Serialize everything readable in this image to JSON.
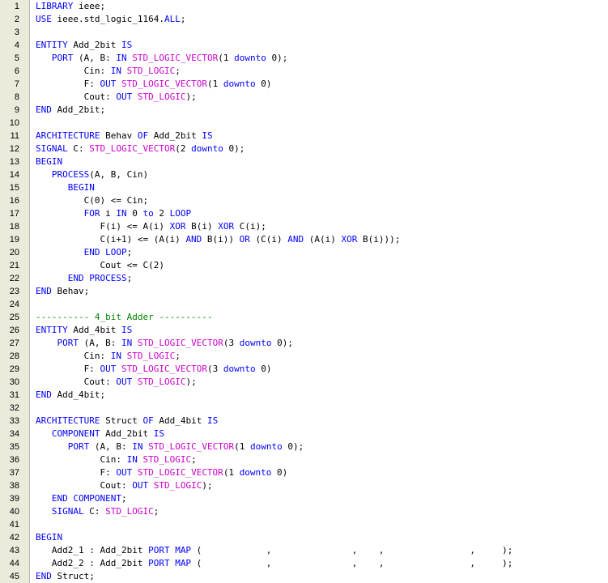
{
  "colors": {
    "keyword": "#0000ff",
    "type": "#cc00cc",
    "comment": "#008000",
    "text": "#000000",
    "gutter": "#ebebdc"
  },
  "lines": [
    [
      [
        "k",
        "LIBRARY"
      ],
      [
        "n",
        " ieee;"
      ]
    ],
    [
      [
        "k",
        "USE"
      ],
      [
        "n",
        " ieee.std_logic_1164."
      ],
      [
        "k",
        "ALL"
      ],
      [
        "n",
        ";"
      ]
    ],
    [],
    [
      [
        "k",
        "ENTITY"
      ],
      [
        "n",
        " Add_2bit "
      ],
      [
        "k",
        "IS"
      ]
    ],
    [
      [
        "n",
        "   "
      ],
      [
        "k",
        "PORT"
      ],
      [
        "n",
        " (A, B: "
      ],
      [
        "k",
        "IN"
      ],
      [
        "n",
        " "
      ],
      [
        "t",
        "STD_LOGIC_VECTOR"
      ],
      [
        "n",
        "(1 "
      ],
      [
        "k",
        "downto"
      ],
      [
        "n",
        " 0);"
      ]
    ],
    [
      [
        "n",
        "         Cin: "
      ],
      [
        "k",
        "IN"
      ],
      [
        "n",
        " "
      ],
      [
        "t",
        "STD_LOGIC"
      ],
      [
        "n",
        ";"
      ]
    ],
    [
      [
        "n",
        "         F: "
      ],
      [
        "k",
        "OUT"
      ],
      [
        "n",
        " "
      ],
      [
        "t",
        "STD_LOGIC_VECTOR"
      ],
      [
        "n",
        "(1 "
      ],
      [
        "k",
        "downto"
      ],
      [
        "n",
        " 0)"
      ]
    ],
    [
      [
        "n",
        "         Cout: "
      ],
      [
        "k",
        "OUT"
      ],
      [
        "n",
        " "
      ],
      [
        "t",
        "STD_LOGIC"
      ],
      [
        "n",
        ");"
      ]
    ],
    [
      [
        "k",
        "END"
      ],
      [
        "n",
        " Add_2bit;"
      ]
    ],
    [],
    [
      [
        "k",
        "ARCHITECTURE"
      ],
      [
        "n",
        " Behav "
      ],
      [
        "k",
        "OF"
      ],
      [
        "n",
        " Add_2bit "
      ],
      [
        "k",
        "IS"
      ]
    ],
    [
      [
        "k",
        "SIGNAL"
      ],
      [
        "n",
        " C: "
      ],
      [
        "t",
        "STD_LOGIC_VECTOR"
      ],
      [
        "n",
        "(2 "
      ],
      [
        "k",
        "downto"
      ],
      [
        "n",
        " 0);"
      ]
    ],
    [
      [
        "k",
        "BEGIN"
      ]
    ],
    [
      [
        "n",
        "   "
      ],
      [
        "k",
        "PROCESS"
      ],
      [
        "n",
        "(A, B, Cin)"
      ]
    ],
    [
      [
        "n",
        "      "
      ],
      [
        "k",
        "BEGIN"
      ]
    ],
    [
      [
        "n",
        "         C(0) <= Cin;"
      ]
    ],
    [
      [
        "n",
        "         "
      ],
      [
        "k",
        "FOR"
      ],
      [
        "n",
        " i "
      ],
      [
        "k",
        "IN"
      ],
      [
        "n",
        " 0 "
      ],
      [
        "k",
        "to"
      ],
      [
        "n",
        " 2 "
      ],
      [
        "k",
        "LOOP"
      ]
    ],
    [
      [
        "n",
        "            F(i) <= A(i) "
      ],
      [
        "k",
        "XOR"
      ],
      [
        "n",
        " B(i) "
      ],
      [
        "k",
        "XOR"
      ],
      [
        "n",
        " C(i);"
      ]
    ],
    [
      [
        "n",
        "            C(i+1) <= (A(i) "
      ],
      [
        "k",
        "AND"
      ],
      [
        "n",
        " B(i)) "
      ],
      [
        "k",
        "OR"
      ],
      [
        "n",
        " (C(i) "
      ],
      [
        "k",
        "AND"
      ],
      [
        "n",
        " (A(i) "
      ],
      [
        "k",
        "XOR"
      ],
      [
        "n",
        " B(i)));"
      ]
    ],
    [
      [
        "n",
        "         "
      ],
      [
        "k",
        "END LOOP"
      ],
      [
        "n",
        ";"
      ]
    ],
    [
      [
        "n",
        "            Cout <= C(2)"
      ]
    ],
    [
      [
        "n",
        "      "
      ],
      [
        "k",
        "END PROCESS"
      ],
      [
        "n",
        ";"
      ]
    ],
    [
      [
        "k",
        "END"
      ],
      [
        "n",
        " Behav;"
      ]
    ],
    [],
    [
      [
        "c",
        "---------- 4_bit Adder ----------"
      ]
    ],
    [
      [
        "k",
        "ENTITY"
      ],
      [
        "n",
        " Add_4bit "
      ],
      [
        "k",
        "IS"
      ]
    ],
    [
      [
        "n",
        "    "
      ],
      [
        "k",
        "PORT"
      ],
      [
        "n",
        " (A, B: "
      ],
      [
        "k",
        "IN"
      ],
      [
        "n",
        " "
      ],
      [
        "t",
        "STD_LOGIC_VECTOR"
      ],
      [
        "n",
        "(3 "
      ],
      [
        "k",
        "downto"
      ],
      [
        "n",
        " 0);"
      ]
    ],
    [
      [
        "n",
        "         Cin: "
      ],
      [
        "k",
        "IN"
      ],
      [
        "n",
        " "
      ],
      [
        "t",
        "STD_LOGIC"
      ],
      [
        "n",
        ";"
      ]
    ],
    [
      [
        "n",
        "         F: "
      ],
      [
        "k",
        "OUT"
      ],
      [
        "n",
        " "
      ],
      [
        "t",
        "STD_LOGIC_VECTOR"
      ],
      [
        "n",
        "(3 "
      ],
      [
        "k",
        "downto"
      ],
      [
        "n",
        " 0)"
      ]
    ],
    [
      [
        "n",
        "         Cout: "
      ],
      [
        "k",
        "OUT"
      ],
      [
        "n",
        " "
      ],
      [
        "t",
        "STD_LOGIC"
      ],
      [
        "n",
        ");"
      ]
    ],
    [
      [
        "k",
        "END"
      ],
      [
        "n",
        " Add_4bit;"
      ]
    ],
    [],
    [
      [
        "k",
        "ARCHITECTURE"
      ],
      [
        "n",
        " Struct "
      ],
      [
        "k",
        "OF"
      ],
      [
        "n",
        " Add_4bit "
      ],
      [
        "k",
        "IS"
      ]
    ],
    [
      [
        "n",
        "   "
      ],
      [
        "k",
        "COMPONENT"
      ],
      [
        "n",
        " Add_2bit "
      ],
      [
        "k",
        "IS"
      ]
    ],
    [
      [
        "n",
        "      "
      ],
      [
        "k",
        "PORT"
      ],
      [
        "n",
        " (A, B: "
      ],
      [
        "k",
        "IN"
      ],
      [
        "n",
        " "
      ],
      [
        "t",
        "STD_LOGIC_VECTOR"
      ],
      [
        "n",
        "(1 "
      ],
      [
        "k",
        "downto"
      ],
      [
        "n",
        " 0);"
      ]
    ],
    [
      [
        "n",
        "            Cin: "
      ],
      [
        "k",
        "IN"
      ],
      [
        "n",
        " "
      ],
      [
        "t",
        "STD_LOGIC"
      ],
      [
        "n",
        ";"
      ]
    ],
    [
      [
        "n",
        "            F: "
      ],
      [
        "k",
        "OUT"
      ],
      [
        "n",
        " "
      ],
      [
        "t",
        "STD_LOGIC_VECTOR"
      ],
      [
        "n",
        "(1 "
      ],
      [
        "k",
        "downto"
      ],
      [
        "n",
        " 0)"
      ]
    ],
    [
      [
        "n",
        "            Cout: "
      ],
      [
        "k",
        "OUT"
      ],
      [
        "n",
        " "
      ],
      [
        "t",
        "STD_LOGIC"
      ],
      [
        "n",
        ");"
      ]
    ],
    [
      [
        "n",
        "   "
      ],
      [
        "k",
        "END COMPONENT"
      ],
      [
        "n",
        ";"
      ]
    ],
    [
      [
        "n",
        "   "
      ],
      [
        "k",
        "SIGNAL"
      ],
      [
        "n",
        " C: "
      ],
      [
        "t",
        "STD_LOGIC"
      ],
      [
        "n",
        ";"
      ]
    ],
    [],
    [
      [
        "k",
        "BEGIN"
      ]
    ],
    [
      [
        "n",
        "   Add2_1 : Add_2bit "
      ],
      [
        "k",
        "PORT MAP"
      ],
      [
        "n",
        " (            ,               ,    ,                ,     );"
      ]
    ],
    [
      [
        "n",
        "   Add2_2 : Add_2bit "
      ],
      [
        "k",
        "PORT MAP"
      ],
      [
        "n",
        " (            ,               ,    ,                ,     );"
      ]
    ],
    [
      [
        "k",
        "END"
      ],
      [
        "n",
        " Struct;"
      ]
    ]
  ]
}
